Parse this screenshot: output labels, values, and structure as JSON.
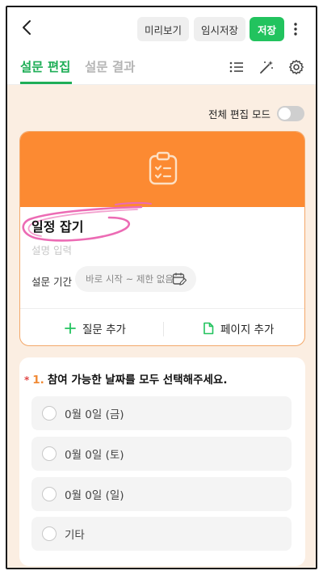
{
  "header": {
    "preview_label": "미리보기",
    "tempsave_label": "임시저장",
    "save_label": "저장"
  },
  "tabs": {
    "edit_label": "설문 편집",
    "result_label": "설문 결과"
  },
  "full_edit_mode": {
    "label": "전체 편집 모드",
    "enabled": false
  },
  "survey": {
    "title": "일정 잡기",
    "description_placeholder": "설명 입력",
    "period_label": "설문 기간",
    "period_value": "바로 시작 ~ 제한 없음"
  },
  "actions": {
    "add_question_label": "질문 추가",
    "add_page_label": "페이지 추가"
  },
  "question": {
    "required_mark": "*",
    "number": "1.",
    "text": "참여 가능한 날짜를 모두 선택해주세요.",
    "options": [
      "0월 0일 (금)",
      "0월 0일 (토)",
      "0월 0일 (일)",
      "기타"
    ]
  },
  "colors": {
    "accent_green": "#22c35e",
    "banner_orange": "#fc8a32",
    "background": "#fbeee2",
    "highlight_pink": "#ec6bb4"
  },
  "icons": {
    "back": "chevron-left-icon",
    "more": "more-vertical-icon",
    "list": "list-icon",
    "magic": "magic-wand-icon",
    "settings": "gear-icon",
    "banner": "clipboard-check-icon",
    "calendar": "calendar-edit-icon",
    "add": "plus-icon",
    "page": "page-icon"
  }
}
